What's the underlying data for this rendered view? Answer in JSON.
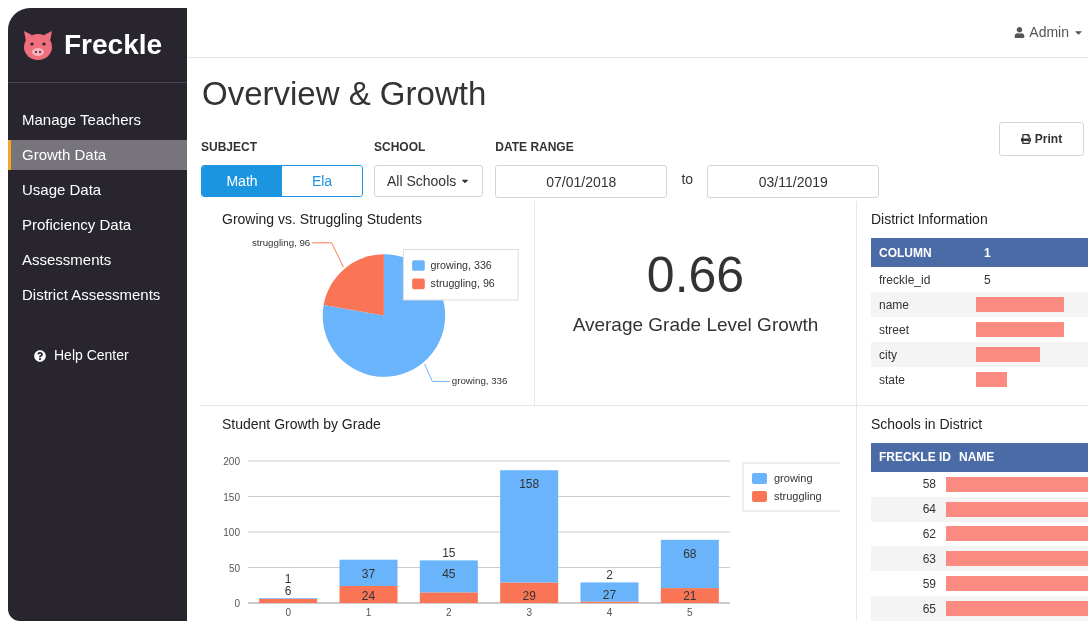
{
  "brand": {
    "name": "Freckle"
  },
  "sidebar": {
    "items": [
      {
        "label": "Manage Teachers",
        "selected": false
      },
      {
        "label": "Growth Data",
        "selected": true
      },
      {
        "label": "Usage Data",
        "selected": false
      },
      {
        "label": "Proficiency Data",
        "selected": false
      },
      {
        "label": "Assessments",
        "selected": false
      },
      {
        "label": "District Assessments",
        "selected": false
      }
    ],
    "help": {
      "label": "Help Center"
    }
  },
  "user_menu": {
    "label": "Admin"
  },
  "page_title": "Overview & Growth",
  "filters": {
    "subject": {
      "label": "SUBJECT",
      "options": [
        {
          "label": "Math",
          "selected": true
        },
        {
          "label": "Ela",
          "selected": false
        }
      ]
    },
    "school": {
      "label": "SCHOOL",
      "value": "All Schools"
    },
    "date_range": {
      "label": "DATE RANGE",
      "start": "07/01/2018",
      "separator": "to",
      "end": "03/11/2019"
    }
  },
  "print_button": {
    "label": "Print"
  },
  "pie_panel": {
    "chart_data": {
      "type": "pie",
      "title": "Growing vs. Struggling Students",
      "categories": [
        "growing, 336",
        "struggling, 96"
      ],
      "series": [
        {
          "values": [
            336,
            96
          ]
        }
      ],
      "colors": [
        "#6ab4fc",
        "#fa7556"
      ],
      "legend": "right"
    },
    "slice_labels": [
      "growing, 336",
      "struggling, 96"
    ]
  },
  "metric": {
    "value": "0.66",
    "label": "Average Grade Level Growth"
  },
  "district_info": {
    "title": "District Information",
    "columns": [
      "COLUMN",
      "1"
    ],
    "rows": [
      {
        "label": "freckle_id",
        "value": "5",
        "redacted": false
      },
      {
        "label": "name",
        "redacted": true
      },
      {
        "label": "street",
        "redacted": true
      },
      {
        "label": "city",
        "redacted": true
      },
      {
        "label": "state",
        "redacted": true
      }
    ]
  },
  "bar_panel": {
    "chart_data": {
      "type": "bar",
      "title": "Student Growth by Grade",
      "categories": [
        "0",
        "1",
        "2",
        "3",
        "4",
        "5"
      ],
      "stacked": true,
      "ylim": [
        0,
        200
      ],
      "yticks": [
        0,
        50,
        100,
        150,
        200
      ],
      "data_labels": true,
      "grid": true,
      "legend": "right",
      "series": [
        {
          "name": "struggling",
          "color": "#fa7556",
          "values": [
            6,
            24,
            15,
            29,
            2,
            21
          ]
        },
        {
          "name": "growing",
          "color": "#6ab4fc",
          "values": [
            1,
            37,
            45,
            158,
            27,
            68
          ]
        }
      ]
    }
  },
  "schools": {
    "title": "Schools in District",
    "columns": [
      "FRECKLE ID",
      "NAME"
    ],
    "rows": [
      {
        "id": "58",
        "redacted": true
      },
      {
        "id": "64",
        "redacted": true
      },
      {
        "id": "62",
        "redacted": true
      },
      {
        "id": "63",
        "redacted": true
      },
      {
        "id": "59",
        "redacted": true
      },
      {
        "id": "65",
        "redacted": true
      }
    ]
  }
}
